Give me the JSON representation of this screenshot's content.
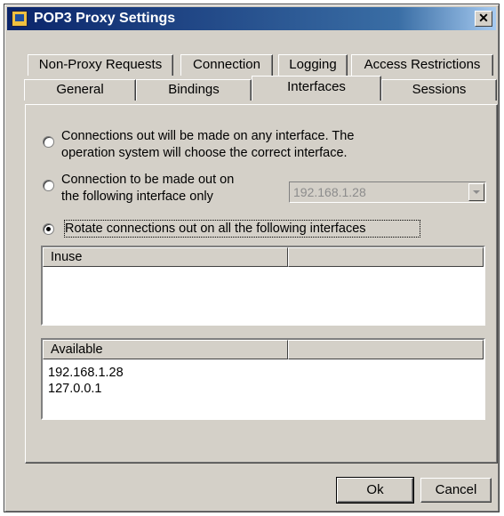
{
  "window": {
    "title": "POP3 Proxy Settings",
    "close_glyph": "✕"
  },
  "tabs_row1": [
    {
      "label": "Non-Proxy Requests"
    },
    {
      "label": "Connection"
    },
    {
      "label": "Logging"
    },
    {
      "label": "Access Restrictions"
    }
  ],
  "tabs_row2": [
    {
      "label": "General"
    },
    {
      "label": "Bindings"
    },
    {
      "label": "Interfaces",
      "active": true
    },
    {
      "label": "Sessions"
    }
  ],
  "options": {
    "any_interface": {
      "line1": "Connections out will be made on any interface. The",
      "line2": "operation system will choose the correct interface.",
      "checked": false
    },
    "specific_interface": {
      "line1": "Connection to be made out on",
      "line2": "the following interface only",
      "checked": false,
      "combo_value": "192.168.1.28"
    },
    "rotate": {
      "label": "Rotate connections out on all the following interfaces",
      "checked": true
    }
  },
  "inuse_list": {
    "header": "Inuse",
    "header2": "",
    "items": []
  },
  "available_list": {
    "header": "Available",
    "header2": "",
    "items": [
      "192.168.1.28",
      "127.0.0.1"
    ]
  },
  "buttons": {
    "ok": "Ok",
    "cancel": "Cancel"
  }
}
